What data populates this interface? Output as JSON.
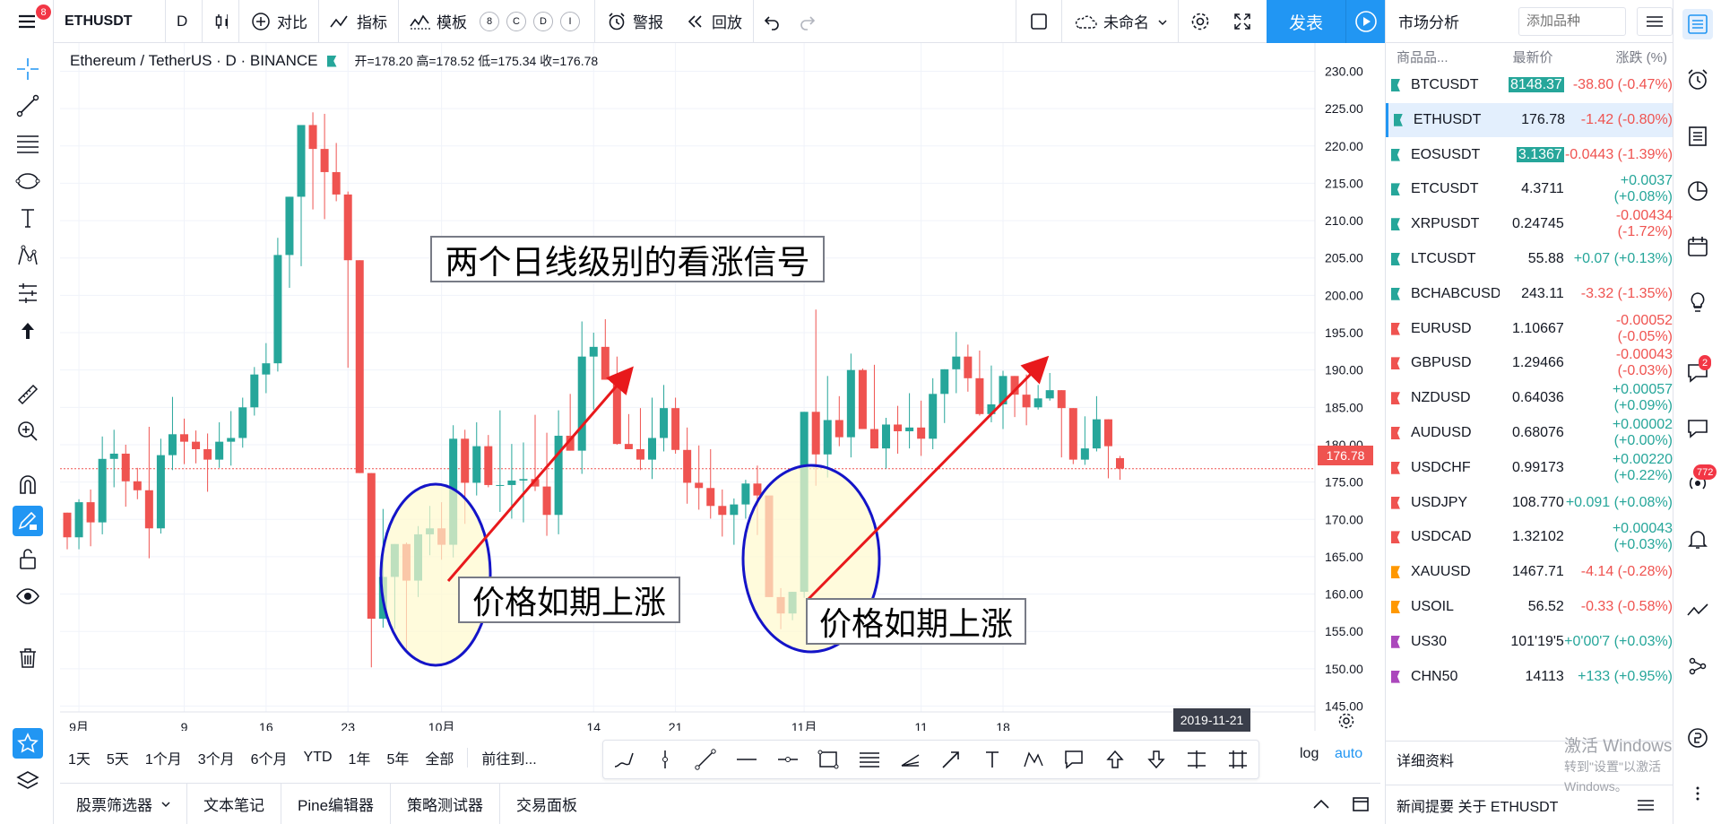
{
  "toolbar": {
    "symbol": "ETHUSDT",
    "interval": "D",
    "compare_label": "对比",
    "indicators_label": "指标",
    "templates_label": "模板",
    "circle_buttons": [
      "8",
      "C",
      "D",
      "I"
    ],
    "alert_label": "警报",
    "replay_label": "回放",
    "layout_name": "未命名",
    "publish_label": "发表",
    "menu_badge": "8"
  },
  "legend": {
    "title": "Ethereum / TetherUS · D · BINANCE",
    "ohlc": "开=178.20 高=178.52 低=175.34 收=176.78"
  },
  "chart_data": {
    "type": "candlestick",
    "symbol": "ETHUSDT",
    "exchange": "BINANCE",
    "interval": "D",
    "y_ticks": [
      "230.00",
      "225.00",
      "220.00",
      "215.00",
      "210.00",
      "205.00",
      "200.00",
      "195.00",
      "190.00",
      "185.00",
      "180.00",
      "175.00",
      "170.00",
      "165.00",
      "160.00",
      "155.00",
      "150.00",
      "145.00"
    ],
    "ylim": [
      143.5,
      234.5
    ],
    "x_ticks": [
      {
        "i": 1,
        "label": "9月"
      },
      {
        "i": 10,
        "label": "9"
      },
      {
        "i": 17,
        "label": "16"
      },
      {
        "i": 24,
        "label": "23"
      },
      {
        "i": 32,
        "label": "10月"
      },
      {
        "i": 45,
        "label": "14"
      },
      {
        "i": 52,
        "label": "21"
      },
      {
        "i": 63,
        "label": "11月"
      },
      {
        "i": 73,
        "label": "11"
      },
      {
        "i": 80,
        "label": "18"
      }
    ],
    "last_price": "176.78",
    "cursor_date": "2019-11-21",
    "candles": [
      [
        170.9,
        169.7,
        166.0,
        167.6
      ],
      [
        167.6,
        172.7,
        166.0,
        172.3
      ],
      [
        172.3,
        174.0,
        166.4,
        169.6
      ],
      [
        169.6,
        181.1,
        168.0,
        178.1
      ],
      [
        178.1,
        182.0,
        174.3,
        178.8
      ],
      [
        178.8,
        180.0,
        171.7,
        175.1
      ],
      [
        175.1,
        176.9,
        172.7,
        173.9
      ],
      [
        173.9,
        182.4,
        164.8,
        168.8
      ],
      [
        168.8,
        180.8,
        168.1,
        178.6
      ],
      [
        178.6,
        186.4,
        176.6,
        181.4
      ],
      [
        181.4,
        183.5,
        177.4,
        180.4
      ],
      [
        180.4,
        181.9,
        177.5,
        179.4
      ],
      [
        179.4,
        181.5,
        173.7,
        178.0
      ],
      [
        178.0,
        183.0,
        176.9,
        180.4
      ],
      [
        180.4,
        184.5,
        177.2,
        180.9
      ],
      [
        180.9,
        186.3,
        179.6,
        185.0
      ],
      [
        185.0,
        190.4,
        183.9,
        189.4
      ],
      [
        189.4,
        193.6,
        186.9,
        190.9
      ],
      [
        190.9,
        207.7,
        189.8,
        205.4
      ],
      [
        205.4,
        211.1,
        201.0,
        213.2
      ],
      [
        213.2,
        219.2,
        203.9,
        222.8
      ],
      [
        222.8,
        224.5,
        211.5,
        219.6
      ],
      [
        219.6,
        224.3,
        210.2,
        216.5
      ],
      [
        216.5,
        220.4,
        212.6,
        213.5
      ],
      [
        213.5,
        213.9,
        190.3,
        204.7
      ],
      [
        204.7,
        204.6,
        198.6,
        176.2
      ],
      [
        176.2,
        175.0,
        150.2,
        156.7
      ],
      [
        156.7,
        171.4,
        155.5,
        162.3
      ],
      [
        162.3,
        166.7,
        155.3,
        166.7
      ],
      [
        166.7,
        166.9,
        152.3,
        161.8
      ],
      [
        161.8,
        169.1,
        159.6,
        168.0
      ],
      [
        168.0,
        171.8,
        165.2,
        168.8
      ],
      [
        168.8,
        172.3,
        164.6,
        166.6
      ],
      [
        166.6,
        182.6,
        164.9,
        180.8
      ],
      [
        180.8,
        182.0,
        169.4,
        174.9
      ],
      [
        174.9,
        183.0,
        173.2,
        179.8
      ],
      [
        179.8,
        181.3,
        174.3,
        174.6
      ],
      [
        174.6,
        184.6,
        171.0,
        174.6
      ],
      [
        174.6,
        180.1,
        170.1,
        175.2
      ],
      [
        175.2,
        180.3,
        169.6,
        175.4
      ],
      [
        175.4,
        184.0,
        173.8,
        174.4
      ],
      [
        174.4,
        181.6,
        167.8,
        170.6
      ],
      [
        170.6,
        184.6,
        168.0,
        181.2
      ],
      [
        181.2,
        186.8,
        179.7,
        179.2
      ],
      [
        179.2,
        196.5,
        176.1,
        191.8
      ],
      [
        191.8,
        195.0,
        184.7,
        193.1
      ],
      [
        193.1,
        196.8,
        190.8,
        188.7
      ],
      [
        188.7,
        191.8,
        180.0,
        180.1
      ],
      [
        180.1,
        184.1,
        179.6,
        179.4
      ],
      [
        179.4,
        184.9,
        176.6,
        178.0
      ],
      [
        178.0,
        186.3,
        175.4,
        180.9
      ],
      [
        180.9,
        188.0,
        179.1,
        184.9
      ],
      [
        184.9,
        186.3,
        178.8,
        179.3
      ],
      [
        179.3,
        182.3,
        172.1,
        174.9
      ],
      [
        174.9,
        179.9,
        171.3,
        174.2
      ],
      [
        174.2,
        179.4,
        170.1,
        171.8
      ],
      [
        171.8,
        174.0,
        167.7,
        170.6
      ],
      [
        170.6,
        172.8,
        166.6,
        172.0
      ],
      [
        172.0,
        175.3,
        170.1,
        174.8
      ],
      [
        174.8,
        177.2,
        167.9,
        173.2
      ],
      [
        173.2,
        171.8,
        160.8,
        159.6
      ],
      [
        159.6,
        160.8,
        155.3,
        157.4
      ],
      [
        157.4,
        160.1,
        156.5,
        160.3
      ],
      [
        160.3,
        177.6,
        159.5,
        184.4
      ],
      [
        184.4,
        198.1,
        174.5,
        178.7
      ],
      [
        178.7,
        189.2,
        175.6,
        183.3
      ],
      [
        183.3,
        186.5,
        179.8,
        181.0
      ],
      [
        181.0,
        192.2,
        178.3,
        190.0
      ],
      [
        190.0,
        190.2,
        184.4,
        182.1
      ],
      [
        182.1,
        190.7,
        179.8,
        179.5
      ],
      [
        179.5,
        183.6,
        176.8,
        182.7
      ],
      [
        182.7,
        185.2,
        178.8,
        181.8
      ],
      [
        181.8,
        186.9,
        179.5,
        182.3
      ],
      [
        182.3,
        185.9,
        178.5,
        180.8
      ],
      [
        180.8,
        188.9,
        179.4,
        186.8
      ],
      [
        186.8,
        189.4,
        182.9,
        190.1
      ],
      [
        190.1,
        195.1,
        186.9,
        191.8
      ],
      [
        191.8,
        193.4,
        187.1,
        188.9
      ],
      [
        188.9,
        192.6,
        183.9,
        184.1
      ],
      [
        184.1,
        190.6,
        183.0,
        185.4
      ],
      [
        185.4,
        189.9,
        182.1,
        189.2
      ],
      [
        189.2,
        188.7,
        183.7,
        186.7
      ],
      [
        186.7,
        189.4,
        182.6,
        185.0
      ],
      [
        185.0,
        188.0,
        184.7,
        186.2
      ],
      [
        186.2,
        189.6,
        185.9,
        187.3
      ],
      [
        187.3,
        186.0,
        178.3,
        184.9
      ],
      [
        184.9,
        181.8,
        177.4,
        178.0
      ],
      [
        178.0,
        183.8,
        177.3,
        179.5
      ],
      [
        179.5,
        186.5,
        179.1,
        183.4
      ],
      [
        183.4,
        182.8,
        175.5,
        179.8
      ],
      [
        178.2,
        178.5,
        175.3,
        176.8
      ]
    ]
  },
  "annotations": {
    "title_box": "两个日线级别的看涨信号",
    "label_1": "价格如期上涨",
    "label_2": "价格如期上涨"
  },
  "range_buttons": [
    "1天",
    "5天",
    "1个月",
    "3个月",
    "6个月",
    "YTD",
    "1年",
    "5年",
    "全部"
  ],
  "goto_label": "前往到...",
  "scale_log": "log",
  "scale_auto": "auto",
  "bottom_tabs": [
    "股票筛选器",
    "文本笔记",
    "Pine编辑器",
    "策略测试器",
    "交易面板"
  ],
  "watchlist": {
    "title": "市场分析",
    "add_placeholder": "添加品种",
    "col_symbol": "商品品...",
    "col_last": "最新价",
    "col_change": "涨跌 (%)",
    "rows": [
      {
        "symbol": "BTCUSDT",
        "last": "8148.37",
        "change": "-38.80 (-0.47%)",
        "dir": "dn",
        "flag": "#26a69a",
        "hl": true
      },
      {
        "symbol": "ETHUSDT",
        "last": "176.78",
        "change": "-1.42 (-0.80%)",
        "dir": "dn",
        "flag": "#26a69a",
        "hl": false
      },
      {
        "symbol": "EOSUSDT",
        "last": "3.1367",
        "change": "-0.0443 (-1.39%)",
        "dir": "dn",
        "flag": "#26a69a",
        "hl": true
      },
      {
        "symbol": "ETCUSDT",
        "last": "4.3711",
        "change": "+0.0037 (+0.08%)",
        "dir": "up",
        "flag": "#26a69a",
        "hl": false
      },
      {
        "symbol": "XRPUSDT",
        "last": "0.24745",
        "change": "-0.00434 (-1.72%)",
        "dir": "dn",
        "flag": "#26a69a",
        "hl": false
      },
      {
        "symbol": "LTCUSDT",
        "last": "55.88",
        "change": "+0.07 (+0.13%)",
        "dir": "up",
        "flag": "#26a69a",
        "hl": false
      },
      {
        "symbol": "BCHABCUSDT",
        "last": "243.11",
        "change": "-3.32 (-1.35%)",
        "dir": "dn",
        "flag": "#26a69a",
        "hl": false
      },
      {
        "symbol": "EURUSD",
        "last": "1.10667",
        "change": "-0.00052 (-0.05%)",
        "dir": "dn",
        "flag": "#ef5350",
        "hl": false
      },
      {
        "symbol": "GBPUSD",
        "last": "1.29466",
        "change": "-0.00043 (-0.03%)",
        "dir": "dn",
        "flag": "#ef5350",
        "hl": false
      },
      {
        "symbol": "NZDUSD",
        "last": "0.64036",
        "change": "+0.00057 (+0.09%)",
        "dir": "up",
        "flag": "#ef5350",
        "hl": false
      },
      {
        "symbol": "AUDUSD",
        "last": "0.68076",
        "change": "+0.00002 (+0.00%)",
        "dir": "up",
        "flag": "#ef5350",
        "hl": false
      },
      {
        "symbol": "USDCHF",
        "last": "0.99173",
        "change": "+0.00220 (+0.22%)",
        "dir": "up",
        "flag": "#ef5350",
        "hl": false
      },
      {
        "symbol": "USDJPY",
        "last": "108.770",
        "change": "+0.091 (+0.08%)",
        "dir": "up",
        "flag": "#ef5350",
        "hl": false
      },
      {
        "symbol": "USDCAD",
        "last": "1.32102",
        "change": "+0.00043 (+0.03%)",
        "dir": "up",
        "flag": "#ef5350",
        "hl": false
      },
      {
        "symbol": "XAUUSD",
        "last": "1467.71",
        "change": "-4.14 (-0.28%)",
        "dir": "dn",
        "flag": "#ff9800",
        "hl": false
      },
      {
        "symbol": "USOIL",
        "last": "56.52",
        "change": "-0.33 (-0.58%)",
        "dir": "dn",
        "flag": "#ff9800",
        "hl": false
      },
      {
        "symbol": "US30",
        "last": "101'19'5",
        "change": "+0'00'7 (+0.03%)",
        "dir": "up",
        "flag": "#ab47bc",
        "hl": false
      },
      {
        "symbol": "CHN50",
        "last": "14113",
        "change": "+133 (+0.95%)",
        "dir": "up",
        "flag": "#ab47bc",
        "hl": false
      }
    ],
    "details_label": "详细资料",
    "news_label": "新闻提要 关于 ETHUSDT"
  },
  "windows_watermark": {
    "line1": "激活 Windows",
    "line2": "转到\"设置\"以激活 Windows。"
  },
  "right_strip": {
    "badge_chat": "2",
    "badge_notif": "772"
  },
  "colors": {
    "up": "#26a69a",
    "down": "#ef5350",
    "accent": "#2196f3",
    "annotation": "#1414c8",
    "arrow": "#e8191c"
  }
}
